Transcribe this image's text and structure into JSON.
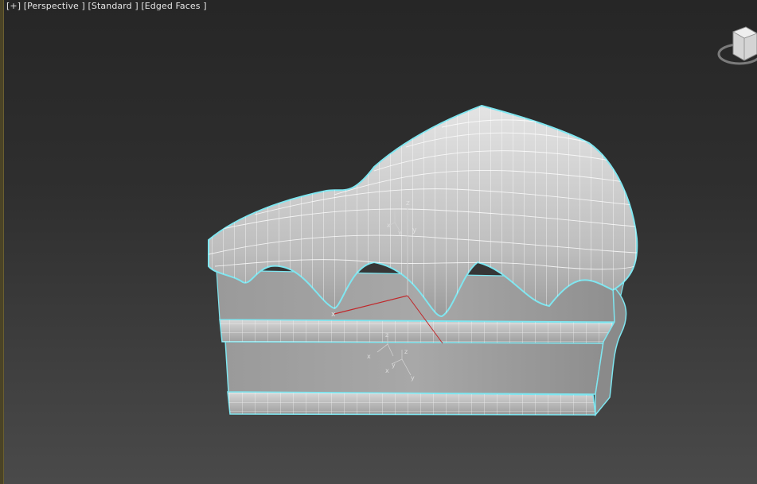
{
  "viewport": {
    "label_plus": "[+]",
    "label_view": "[Perspective ]",
    "label_shading": "[Standard ]",
    "label_edged": "[Edged Faces ]",
    "background_top": "#262626",
    "background_bottom": "#4a4a4a",
    "selection_color": "#7fe6f0",
    "wireframe_color": "#ffffff"
  },
  "gizmo": {
    "labels": [
      "x",
      "z",
      "y"
    ],
    "x_axis_color": "#c0282b",
    "z_axis_color": "#cfcfcf"
  },
  "viewcube": {
    "icon": "viewcube-icon",
    "ring_color": "#8a8a8a"
  }
}
